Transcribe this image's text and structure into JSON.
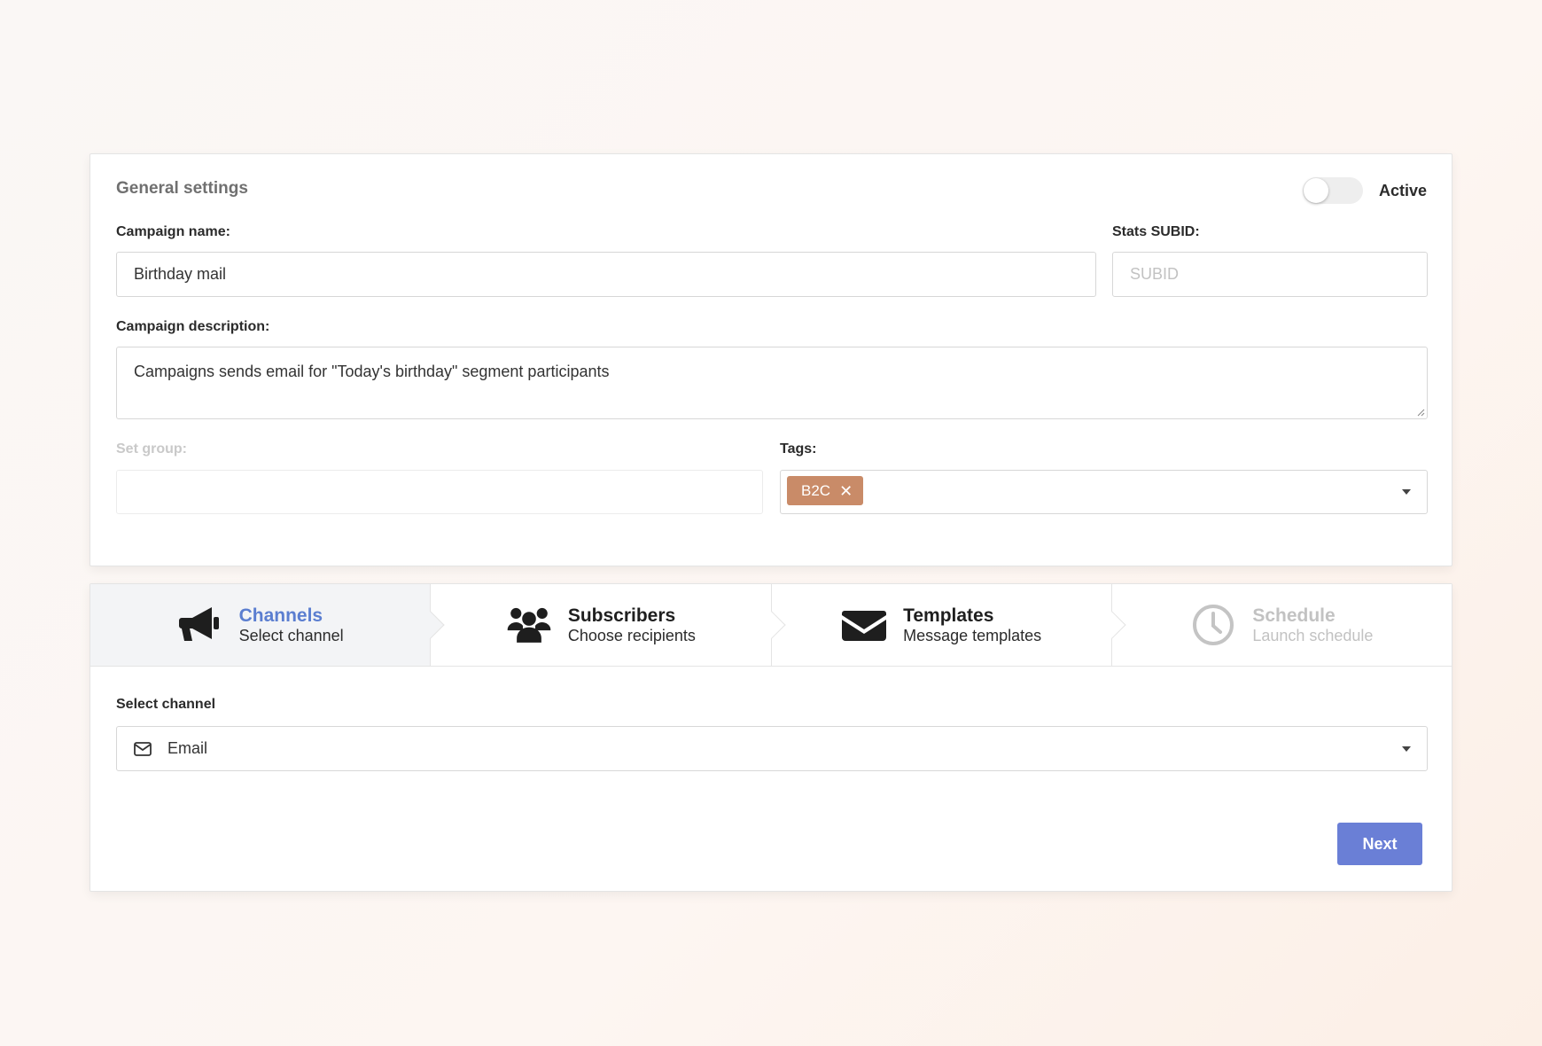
{
  "general": {
    "title": "General settings",
    "active_label": "Active",
    "active_on": false,
    "campaign_name_label": "Campaign name:",
    "campaign_name_value": "Birthday mail",
    "stats_subid_label": "Stats SUBID:",
    "stats_subid_placeholder": "SUBID",
    "description_label": "Campaign description:",
    "description_value": "Campaigns sends email for \"Today's birthday\" segment participants",
    "group_label": "Set group:",
    "group_value": "",
    "tags_label": "Tags:",
    "tags": [
      {
        "label": "B2C",
        "color": "#c98b68"
      }
    ]
  },
  "steps": [
    {
      "title": "Channels",
      "subtitle": "Select channel",
      "icon": "megaphone-icon",
      "state": "active"
    },
    {
      "title": "Subscribers",
      "subtitle": "Choose recipients",
      "icon": "users-icon",
      "state": "normal"
    },
    {
      "title": "Templates",
      "subtitle": "Message templates",
      "icon": "envelope-icon",
      "state": "normal"
    },
    {
      "title": "Schedule",
      "subtitle": "Launch schedule",
      "icon": "clock-icon",
      "state": "disabled"
    }
  ],
  "channel": {
    "label": "Select channel",
    "selected": "Email",
    "icon": "envelope-outline-icon"
  },
  "actions": {
    "next_label": "Next"
  },
  "colors": {
    "accent": "#5b7ed0",
    "button": "#6a7fd6",
    "tag": "#c98b68"
  }
}
